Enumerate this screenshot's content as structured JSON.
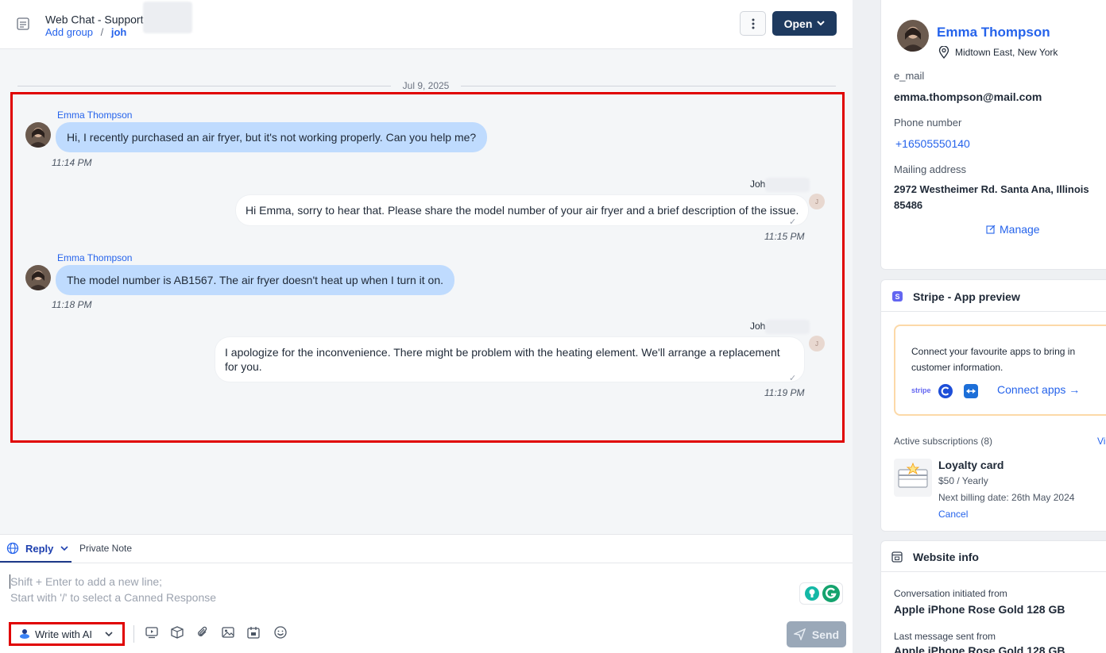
{
  "header": {
    "title": "Web Chat - Support",
    "breadcrumb_group": "Add group",
    "breadcrumb_sep": "/",
    "breadcrumb_agent": "joh",
    "status_button": "Open"
  },
  "chat": {
    "date": "Jul 9, 2025",
    "messages": [
      {
        "sender": "Emma Thompson",
        "text": "Hi, I recently purchased an air fryer, but it's not working properly. Can you help me?",
        "time": "11:14 PM"
      },
      {
        "sender": "Joh",
        "text": "Hi Emma, sorry to hear that. Please share the model number of your air fryer and a brief description of the issue.",
        "time": "11:15 PM",
        "avatar": "J"
      },
      {
        "sender": "Emma Thompson",
        "text": "The model number is AB1567. The air fryer doesn't heat up when I turn it on.",
        "time": "11:18 PM"
      },
      {
        "sender": "Joh",
        "text": "I apologize for the inconvenience. There might be problem with the heating element. We'll arrange a replacement for you.",
        "time": "11:19 PM",
        "avatar": "J"
      }
    ]
  },
  "composer": {
    "tab_reply": "Reply",
    "tab_note": "Private Note",
    "placeholder_line1": "Shift + Enter to add a new line;",
    "placeholder_line2": "Start with '/' to select a Canned Response",
    "ai_button": "Write with AI",
    "send_button": "Send"
  },
  "contact": {
    "name": "Emma Thompson",
    "location": "Midtown East, New York",
    "email_label": "e_mail",
    "email": "emma.thompson@mail.com",
    "phone_label": "Phone number",
    "phone": "+16505550140",
    "address_label": "Mailing address",
    "address_line1": "2972 Westheimer Rd. Santa Ana, Illinois",
    "address_line2": "85486",
    "manage": "Manage"
  },
  "stripe": {
    "title": "Stripe - App preview",
    "connect_text": "Connect your favourite apps to bring in customer information.",
    "stripe_logo": "stripe",
    "connect_link": "Connect apps →",
    "subs_label": "Active subscriptions (8)",
    "subs_view": "Vi",
    "card_title": "Loyalty card",
    "card_price": "$50 / Yearly",
    "card_next": "Next billing date: 26th May 2024",
    "card_cancel": "Cancel"
  },
  "website": {
    "title": "Website info",
    "initiated_label": "Conversation initiated from",
    "initiated_value": "Apple iPhone Rose Gold 128 GB",
    "last_label": "Last message sent from",
    "last_value": "Apple iPhone Rose Gold 128 GB"
  },
  "colors": {
    "accent": "#2563eb",
    "open_button": "#1e3a5f",
    "incoming_bubble": "#bfdbfe",
    "annotation_red": "#e00000"
  }
}
